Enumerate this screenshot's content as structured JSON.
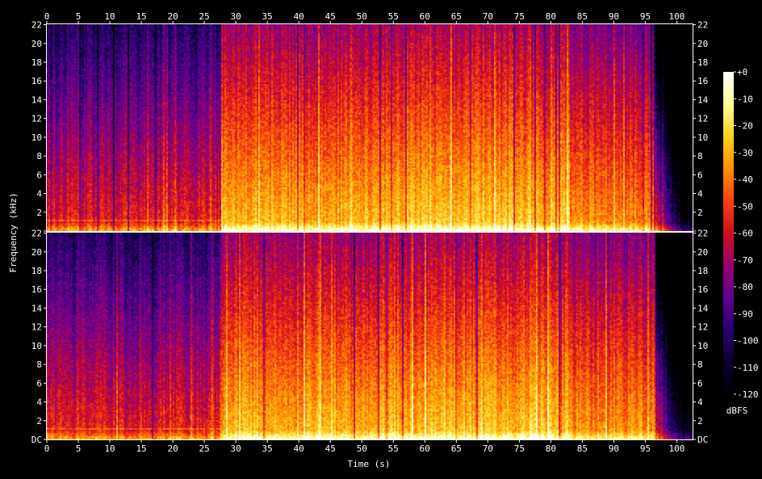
{
  "chart_data": {
    "type": "heatmap",
    "xlabel": "Time (s)",
    "ylabel": "Frequency (kHz)",
    "xlim": [
      0,
      102.5
    ],
    "ylim_khz": [
      0,
      22.05
    ],
    "x_ticks": [
      0,
      5,
      10,
      15,
      20,
      25,
      30,
      35,
      40,
      45,
      50,
      55,
      60,
      65,
      70,
      75,
      80,
      85,
      90,
      95,
      100
    ],
    "y_ticks": [
      0,
      2,
      4,
      6,
      8,
      10,
      12,
      14,
      16,
      18,
      20,
      22
    ],
    "y_tick_labels_top": [
      "",
      "2",
      "4",
      "6",
      "8",
      "10",
      "12",
      "14",
      "16",
      "18",
      "20",
      "22"
    ],
    "y_tick_labels_bottom": [
      "DC",
      "2",
      "4",
      "6",
      "8",
      "10",
      "12",
      "14",
      "16",
      "18",
      "20",
      "22"
    ],
    "channels": 2,
    "colorbar": {
      "label": "dBFS",
      "range": [
        -120,
        0
      ],
      "ticks": [
        0,
        -10,
        -20,
        -30,
        -40,
        -50,
        -60,
        -70,
        -80,
        -90,
        -100,
        -110,
        -120
      ],
      "tick_labels": [
        "+0",
        "-10",
        "-20",
        "-30",
        "-40",
        "-50",
        "-60",
        "-70",
        "-80",
        "-90",
        "-100",
        "-110",
        "-120"
      ],
      "colors": [
        "#000000",
        "#0a0030",
        "#280070",
        "#600090",
        "#980070",
        "#d01020",
        "#f84010",
        "#ff9000",
        "#ffd020",
        "#ffff90",
        "#ffffff"
      ]
    },
    "loudness_segments": [
      {
        "t_start": 0,
        "t_end": 27.5,
        "level": 0.55
      },
      {
        "t_start": 27.5,
        "t_end": 53,
        "level": 0.78
      },
      {
        "t_start": 53,
        "t_end": 62,
        "level": 0.8
      },
      {
        "t_start": 62,
        "t_end": 83,
        "level": 0.8
      },
      {
        "t_start": 83,
        "t_end": 96.5,
        "level": 0.72
      },
      {
        "t_start": 96.5,
        "t_end": 102.5,
        "level": 0.15
      }
    ]
  }
}
